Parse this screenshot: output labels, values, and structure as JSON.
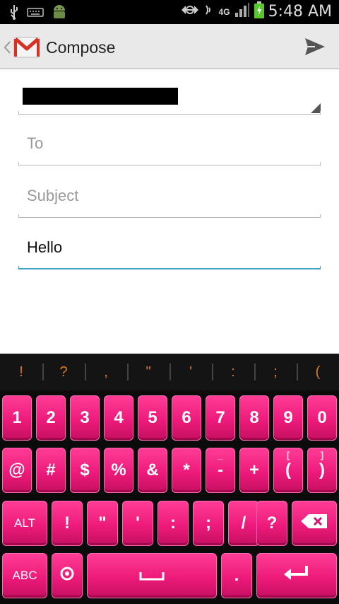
{
  "status_bar": {
    "time": "5:48 AM",
    "network": "4G",
    "icons": [
      "usb-icon",
      "keyboard-icon",
      "android-icon",
      "sync-icon",
      "wifi-icon",
      "signal-icon",
      "battery-icon"
    ]
  },
  "action_bar": {
    "title": "Compose",
    "icons": [
      "back-chevron-icon",
      "gmail-icon",
      "send-icon"
    ]
  },
  "compose": {
    "from_value": "",
    "to_placeholder": "To",
    "subject_placeholder": "Subject",
    "body_value": "Hello"
  },
  "keyboard": {
    "suggestions": [
      "!",
      "?",
      ",",
      "\"",
      "'",
      ":",
      ";",
      "("
    ],
    "row1": [
      "1",
      "2",
      "3",
      "4",
      "5",
      "6",
      "7",
      "8",
      "9",
      "0"
    ],
    "row2": [
      {
        "label": "@",
        "sup": ""
      },
      {
        "label": "#",
        "sup": ""
      },
      {
        "label": "$",
        "sup": ""
      },
      {
        "label": "%",
        "sup": ""
      },
      {
        "label": "&",
        "sup": ""
      },
      {
        "label": "*",
        "sup": ""
      },
      {
        "label": "-",
        "sup": "_"
      },
      {
        "label": "+",
        "sup": ""
      },
      {
        "label": "(",
        "sup": "["
      },
      {
        "label": ")",
        "sup": "]"
      }
    ],
    "row3": [
      "ALT",
      "!",
      "\"",
      "'",
      ":",
      ";",
      "/",
      "?"
    ],
    "row4": {
      "abc": "ABC",
      "period": "."
    },
    "accent_color": "#ee1a7b",
    "suggestion_color": "#e07b1a",
    "focus_color": "#3fa2c4"
  }
}
